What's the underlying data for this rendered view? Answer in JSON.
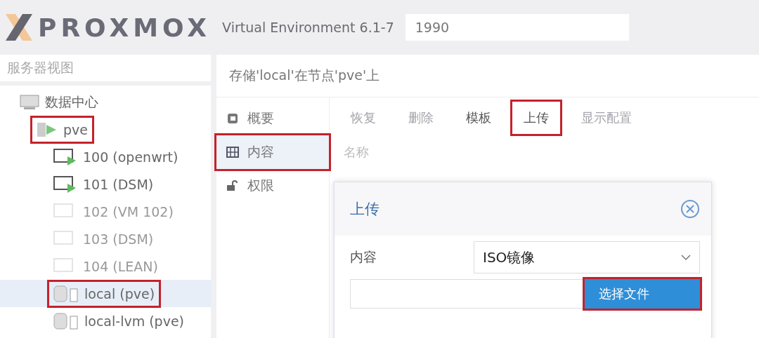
{
  "header": {
    "brand": "PROXMOX",
    "product": "Virtual Environment 6.1-7",
    "search": {
      "value": "1990"
    }
  },
  "view_selector": {
    "value": "服务器视图"
  },
  "tree": [
    {
      "label": "数据中心",
      "kind": "datacenter",
      "selected": false,
      "highlighted": false,
      "children": [
        {
          "label": "pve",
          "kind": "node",
          "selected": false,
          "highlighted": true,
          "children": [
            {
              "label": "100 (openwrt)",
              "kind": "vm",
              "running": true,
              "selected": false,
              "highlighted": false
            },
            {
              "label": "101 (DSM)",
              "kind": "vm",
              "running": true,
              "selected": false,
              "highlighted": false
            },
            {
              "label": "102 (VM 102)",
              "kind": "vm",
              "running": false,
              "selected": false,
              "highlighted": false
            },
            {
              "label": "103 (DSM)",
              "kind": "vm",
              "running": false,
              "selected": false,
              "highlighted": false
            },
            {
              "label": "104 (LEAN)",
              "kind": "vm",
              "running": false,
              "selected": false,
              "highlighted": false
            },
            {
              "label": "local (pve)",
              "kind": "storage",
              "selected": true,
              "highlighted": true
            },
            {
              "label": "local-lvm (pve)",
              "kind": "storage",
              "selected": false,
              "highlighted": false
            }
          ]
        }
      ]
    }
  ],
  "content": {
    "title": "存储'local'在节点'pve'上",
    "nav": [
      {
        "label": "概要",
        "kind": "summary",
        "selected": false,
        "highlighted": false
      },
      {
        "label": "内容",
        "kind": "content",
        "selected": true,
        "highlighted": true
      },
      {
        "label": "权限",
        "kind": "permissions",
        "selected": false,
        "highlighted": false
      }
    ],
    "toolbar": [
      {
        "label": "恢复",
        "disabled": true,
        "highlighted": false
      },
      {
        "label": "删除",
        "disabled": true,
        "highlighted": false
      },
      {
        "label": "模板",
        "disabled": false,
        "highlighted": false
      },
      {
        "label": "上传",
        "disabled": false,
        "highlighted": true
      },
      {
        "label": "显示配置",
        "disabled": true,
        "highlighted": false
      }
    ],
    "columns": [
      "名称"
    ]
  },
  "dialog": {
    "title": "上传",
    "content_label": "内容",
    "content_value": "ISO镜像",
    "choose_button": {
      "label": "选择文件",
      "highlighted": true
    }
  }
}
